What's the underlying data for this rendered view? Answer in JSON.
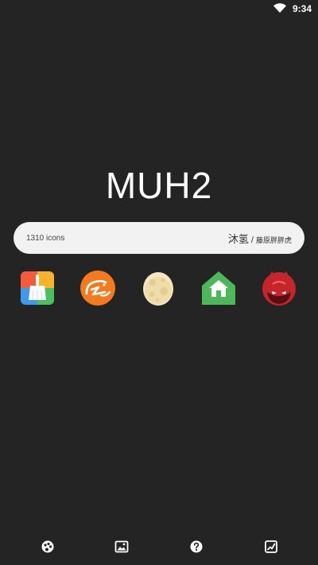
{
  "status_bar": {
    "time": "9:34",
    "icons": [
      "wifi-icon"
    ]
  },
  "header": {
    "title": "MUH2"
  },
  "info_bar": {
    "icon_count": "1310 icons",
    "credit_main": "沐氢",
    "credit_separator": "/",
    "credit_sub": "藤原胖胖虎"
  },
  "featured_icons": [
    "cleaner-broom-icon",
    "alibaba-icon",
    "egg-icon",
    "home-icon",
    "antutu-devil-icon"
  ],
  "bottom_nav": {
    "items": [
      "icons-tab-icon",
      "wallpaper-tab-icon",
      "request-tab-icon",
      "apply-tab-icon"
    ]
  },
  "colors": {
    "background": "#242424",
    "bar_background": "#f2f2f2",
    "text_on_dark": "#ffffff",
    "alibaba_orange": "#f47a1f",
    "home_green": "#4cb85a",
    "antutu_red": "#c5262c"
  }
}
